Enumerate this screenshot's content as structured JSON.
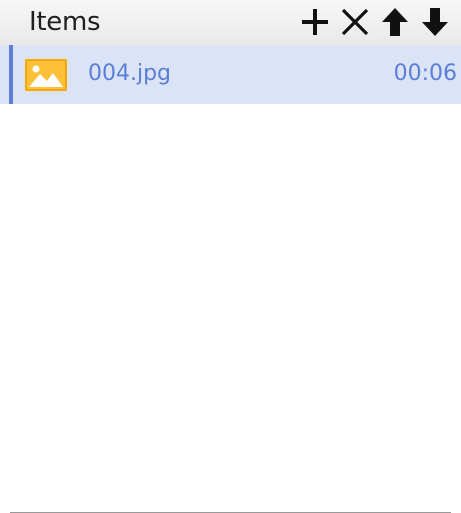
{
  "header": {
    "title": "Items",
    "actions": [
      {
        "name": "add",
        "icon": "plus-icon"
      },
      {
        "name": "remove",
        "icon": "close-icon"
      },
      {
        "name": "move-up",
        "icon": "arrow-up-icon"
      },
      {
        "name": "move-down",
        "icon": "arrow-down-icon"
      }
    ]
  },
  "items": [
    {
      "name": "004.jpg",
      "time": "00:06",
      "icon": "image-icon",
      "selected": true
    }
  ],
  "colors": {
    "accent": "#5b7fd6",
    "selected_bg": "#dbe3f6",
    "icon_orange": "#f5a800"
  }
}
